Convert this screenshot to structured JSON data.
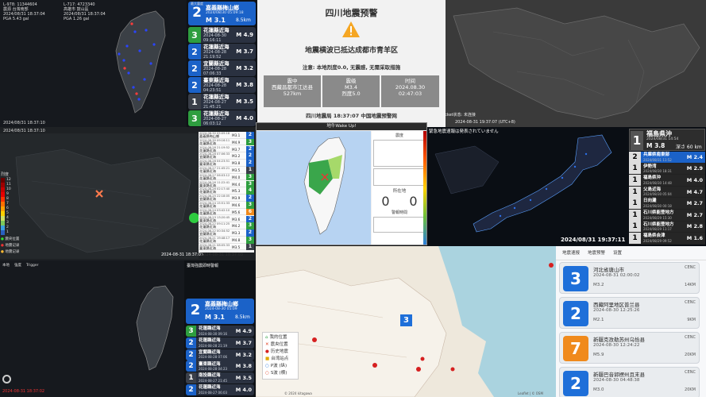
{
  "p1": {
    "info_left": [
      "L-978: 11344604",
      "震源 台灣南部",
      "2024/08/31 18:37:04",
      "PGA 5.43 gal"
    ],
    "info_right": [
      "L-717: 4723340",
      "高雄市 鼓山區",
      "2024/08/31 18:37:04",
      "PGA 1.26 gal"
    ],
    "footer": "2024/08/31 18:37:10"
  },
  "p2": {
    "main": {
      "label": "最大震度",
      "int": "2",
      "loc": "嘉義縣梅山鄉",
      "date": "2024/08/30 05:09:18",
      "mag": "M 3.1",
      "depth": "8.5km"
    },
    "rows": [
      {
        "int": "3",
        "loc": "花蓮縣近海",
        "date": "2024-08-30 09:16:11",
        "mag": "M 4.9"
      },
      {
        "int": "2",
        "loc": "花蓮縣近海",
        "date": "2024-08-28 21:19:52",
        "mag": "M 3.7"
      },
      {
        "int": "2",
        "loc": "宜蘭縣近海",
        "date": "2024-08-28 07:06:33",
        "mag": "M 3.2"
      },
      {
        "int": "2",
        "loc": "臺東縣近海",
        "date": "2024-08-28 04:23:51",
        "mag": "M 3.8"
      },
      {
        "int": "1",
        "loc": "花蓮縣近海",
        "date": "2024-08-27 21:45:21",
        "mag": "M 3.5"
      },
      {
        "int": "3",
        "loc": "花蓮縣近海",
        "date": "2024-08-27 06:03:12",
        "mag": "M 4.0"
      }
    ]
  },
  "p3": {
    "title": "四川地震预警",
    "subtitle": "地震横波已抵达成都市青羊区",
    "note": "注意: 本地烈度0.0, 无震感, 无需采取措施",
    "epicenter_label": "震中",
    "epicenter": "西藏昌都市江达县",
    "distance": "527km",
    "magnitude_label": "震级",
    "magnitude": "M3.4",
    "intensity": "烈度5.0",
    "time_label": "时间",
    "date": "2024.08.30",
    "time": "02:47:03",
    "footer": "四川地震局 18:37:07 中国地震预警网"
  },
  "p4": {
    "status": "WebSocket状态: 未连接",
    "timestamp": "2024-08-31 19:37:07 (UTC+8)"
  },
  "p5": {
    "header": "2024/08/31 18:37:10",
    "legend_title": "烈度",
    "legend": [
      "12",
      "11",
      "10",
      "9",
      "8",
      "7",
      "6",
      "5",
      "4",
      "3",
      "2",
      "1"
    ],
    "legend_items": [
      "震央位置",
      "地震记录",
      "地震记录"
    ],
    "rows": [
      {
        "date": "2024-08-30 05:09:18",
        "loc": "嘉義縣梅山鄉",
        "mag": "M3.1",
        "int": "2"
      },
      {
        "date": "2024-08-30 09:16:11",
        "loc": "花蓮縣近海",
        "mag": "M4.9",
        "int": "3"
      },
      {
        "date": "2024-08-28 21:19:52",
        "loc": "花蓮縣近海",
        "mag": "M3.7",
        "int": "2"
      },
      {
        "date": "2024-08-28 07:06:33",
        "loc": "宜蘭縣近海",
        "mag": "M3.2",
        "int": "2"
      },
      {
        "date": "2024-08-28 04:23:51",
        "loc": "臺東縣近海",
        "mag": "M3.8",
        "int": "2"
      },
      {
        "date": "2024-08-27 21:45:21",
        "loc": "花蓮縣近海",
        "mag": "M3.5",
        "int": "1"
      },
      {
        "date": "2024-08-27 06:03:12",
        "loc": "花蓮縣近海",
        "mag": "M4.0",
        "int": "3"
      },
      {
        "date": "2024-08-26 11:22:41",
        "loc": "臺東縣近海",
        "mag": "M4.4",
        "int": "3"
      },
      {
        "date": "2024-08-26 02:17:40",
        "loc": "花蓮縣近海",
        "mag": "M5.3",
        "int": "4"
      },
      {
        "date": "2024-08-25 22:18:05",
        "loc": "宜蘭縣近海",
        "mag": "M3.9",
        "int": "2"
      },
      {
        "date": "2024-08-24 15:51:33",
        "loc": "花蓮縣近海",
        "mag": "M4.6",
        "int": "3"
      },
      {
        "date": "2024-08-24 03:42:10",
        "loc": "花蓮縣近海",
        "mag": "M5.6",
        "int": "6"
      },
      {
        "date": "2024-08-23 13:20:45",
        "loc": "臺東縣近海",
        "mag": "M3.6",
        "int": "2"
      },
      {
        "date": "2024-08-22 09:11:25",
        "loc": "花蓮縣近海",
        "mag": "M4.2",
        "int": "3"
      },
      {
        "date": "2024-08-22 00:34:52",
        "loc": "宜蘭縣近海",
        "mag": "M3.3",
        "int": "2"
      },
      {
        "date": "2024-08-21 19:48:17",
        "loc": "花蓮縣近海",
        "mag": "M4.8",
        "int": "3"
      },
      {
        "date": "2024-08-21 08:05:33",
        "loc": "臺東縣近海",
        "mag": "M3.5",
        "int": "1"
      }
    ],
    "footer": "2024-08-31 18:37:03",
    "footer_right": "2024-08-31 18:37:03"
  },
  "p6": {
    "title": "地牛Wake Up!",
    "box_title": "震度",
    "local_label": "所在地",
    "local_values": [
      "0",
      "0"
    ],
    "alarm": "警報時間"
  },
  "p7": {
    "banner": "緊急地震速報は発表されていません",
    "main": {
      "int": "1",
      "loc": "福島県沖",
      "date": "2024/08/31 14:54",
      "mag": "M 3.8",
      "depth": "深さ 60 km"
    },
    "rows": [
      {
        "int": "2",
        "loc": "兵庫県南東部",
        "date": "2024/08/31 11:52",
        "mag": "M 2.4"
      },
      {
        "int": "1",
        "loc": "伊勢湾",
        "date": "2024/08/30 18:31",
        "mag": "M 2.9"
      },
      {
        "int": "1",
        "loc": "福島県沖",
        "date": "2024/08/30 14:48",
        "mag": "M 4.0"
      },
      {
        "int": "1",
        "loc": "父島近海",
        "date": "2024/08/30 05:04",
        "mag": "M 4.7"
      },
      {
        "int": "1",
        "loc": "日向灘",
        "date": "2024/08/30 00:18",
        "mag": "M 2.7"
      },
      {
        "int": "1",
        "loc": "石川県能登地方",
        "date": "2024/08/29 15:30",
        "mag": "M 2.7"
      },
      {
        "int": "1",
        "loc": "石川県能登地方",
        "date": "2024/08/29 11:17",
        "mag": "M 2.8"
      },
      {
        "int": "1",
        "loc": "福島県会津",
        "date": "2024/08/29 09:52",
        "mag": "M 1.6"
      }
    ],
    "clock": "2024/08/31 19:37:11"
  },
  "p8": {
    "header": "臺灣強震即時警報",
    "items": [
      "本地",
      "強度",
      "Trigger"
    ],
    "main": {
      "int": "2",
      "loc": "嘉義縣梅山鄉",
      "date": "2024-08-30 05:09",
      "mag": "M 3.1",
      "depth": "8.5km"
    },
    "rows": [
      {
        "int": "3",
        "loc": "花蓮縣近海",
        "date": "2024-08-30 09:16",
        "mag": "M 4.9"
      },
      {
        "int": "2",
        "loc": "花蓮縣近海",
        "date": "2024-08-28 21:19",
        "mag": "M 3.7"
      },
      {
        "int": "2",
        "loc": "宜蘭縣近海",
        "date": "2024-08-28 07:06",
        "mag": "M 3.2"
      },
      {
        "int": "2",
        "loc": "臺東縣近海",
        "date": "2024-08-28 04:23",
        "mag": "M 3.8"
      },
      {
        "int": "1",
        "loc": "南投縣近海",
        "date": "2024-08-27 21:45",
        "mag": "M 3.5"
      },
      {
        "int": "2",
        "loc": "花蓮縣近海",
        "date": "2024-08-27 06:03",
        "mag": "M 4.0"
      }
    ],
    "footer": "2024-08-31 18:37:02"
  },
  "p9": {
    "legend": [
      "我的位置",
      "震央位置",
      "历史地震",
      "台湾站点",
      "P波 (纵)",
      "S波 (横)"
    ],
    "marker": "3",
    "footer": "© 2024 kitagawa",
    "attribution": "Leaflet | © OSM"
  },
  "p10": {
    "tabs": [
      "地震速报",
      "地震预警",
      "设置"
    ],
    "cards": [
      {
        "int": "3",
        "loc": "河北省唐山市",
        "date": "2024-08-31 02:00:02",
        "mag": "M3.2",
        "src": "CENC",
        "dist": "14KM",
        "color": "#1e6fd9"
      },
      {
        "int": "2",
        "loc": "西藏阿里地区普兰县",
        "date": "2024-08-30 12:25:26",
        "mag": "M2.1",
        "src": "CENC",
        "dist": "9KM",
        "color": "#1e6fd9"
      },
      {
        "int": "7",
        "loc": "新疆克孜勒苏州乌恰县",
        "date": "2024-08-30 12:24:22",
        "mag": "M5.9",
        "src": "CENC",
        "dist": "20KM",
        "color": "#f08a1c"
      },
      {
        "int": "2",
        "loc": "新疆巴音郭楞州且末县",
        "date": "2024-08-30 04:48:38",
        "mag": "M3.0",
        "src": "CENC",
        "dist": "20KM",
        "color": "#1e6fd9"
      }
    ]
  }
}
